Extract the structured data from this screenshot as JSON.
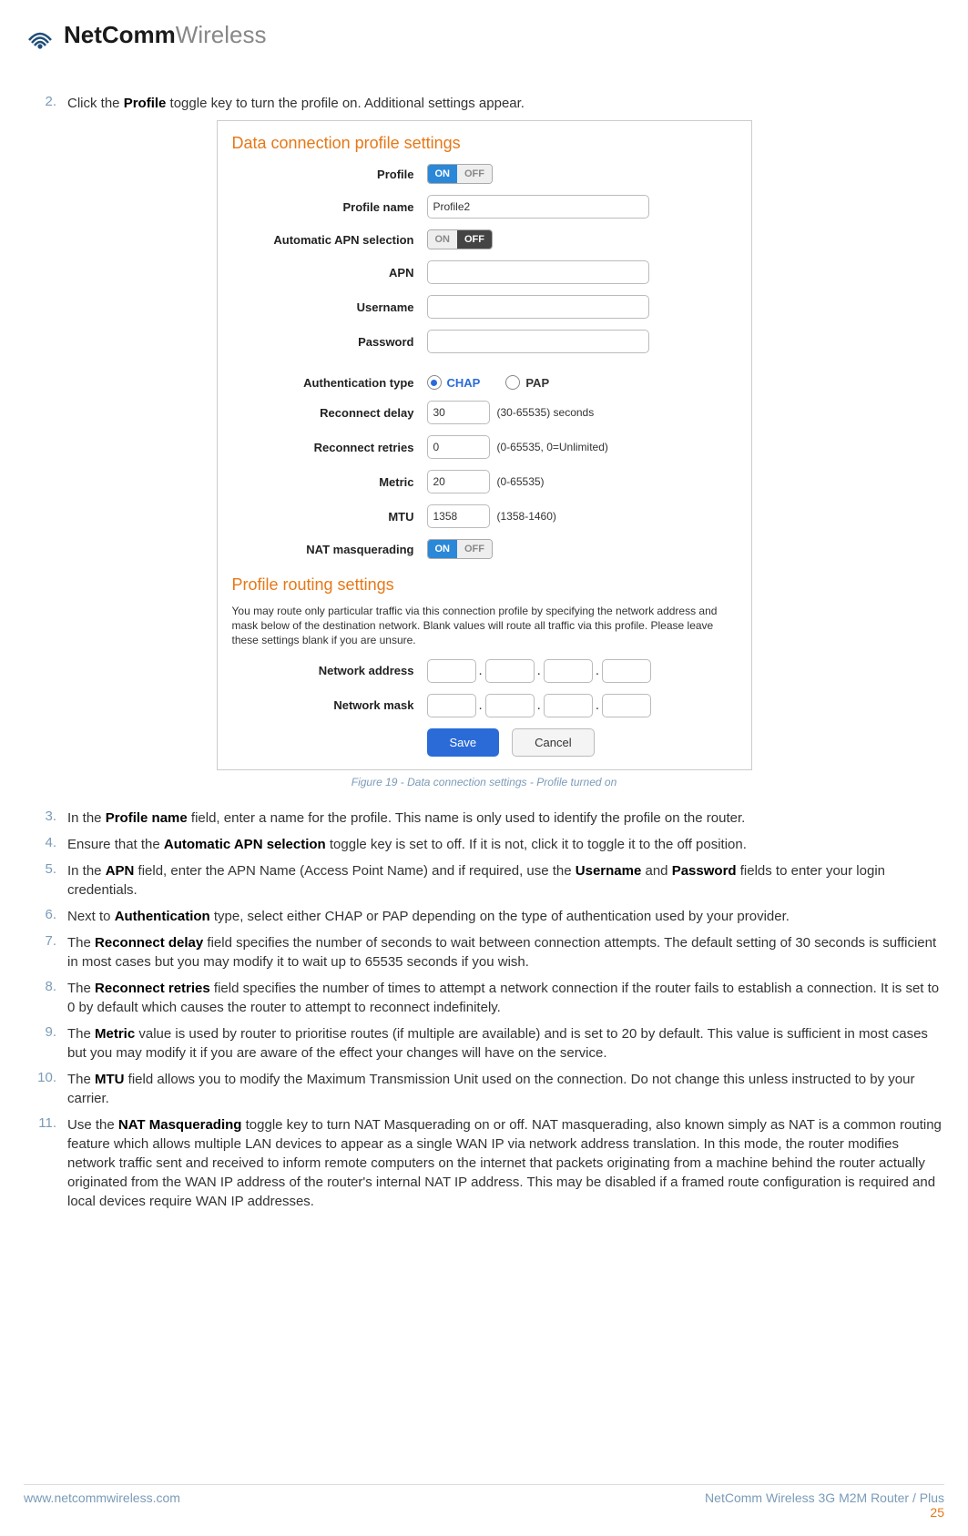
{
  "brand": {
    "bold": "NetComm",
    "light": "Wireless"
  },
  "steps": {
    "s2": {
      "n": "2.",
      "pre": "Click the ",
      "b": "Profile",
      "post": " toggle key to turn the profile on. Additional settings appear."
    },
    "s3": {
      "n": "3.",
      "pre": "In the ",
      "b": "Profile name",
      "post": " field, enter a name for the profile. This name is only used to identify the profile on the router."
    },
    "s4": {
      "n": "4.",
      "pre": "Ensure that the ",
      "b": "Automatic APN selection",
      "post": " toggle key is set to off. If it is not, click it to toggle it to the off position."
    },
    "s5": {
      "n": "5.",
      "pre": "In the ",
      "b1": "APN",
      "mid1": " field, enter the APN Name (Access Point Name) and if required, use the ",
      "b2": "Username",
      "mid2": " and ",
      "b3": "Password",
      "post": " fields to enter your login credentials."
    },
    "s6": {
      "n": "6.",
      "pre": "Next to ",
      "b": "Authentication",
      "post": " type, select either CHAP or PAP depending on the type of authentication used by your provider."
    },
    "s7": {
      "n": "7.",
      "pre": "The ",
      "b": "Reconnect delay",
      "post": " field specifies the number of seconds to wait between connection attempts. The default setting of 30 seconds is sufficient in most cases but you may modify it to wait up to 65535 seconds if you wish."
    },
    "s8": {
      "n": "8.",
      "pre": "The ",
      "b": "Reconnect retries",
      "post": " field specifies the number of times to attempt a network connection if the router fails to establish a connection. It is set to 0 by default which causes the router to attempt to reconnect indefinitely."
    },
    "s9": {
      "n": "9.",
      "pre": "The ",
      "b": "Metric",
      "post": " value is used by router to prioritise routes (if multiple are available) and is set to 20 by default. This value is sufficient in most cases but you may modify it if you are aware of the effect your changes will have on the service."
    },
    "s10": {
      "n": "10.",
      "pre": "The ",
      "b": "MTU",
      "post": " field allows you to modify the Maximum Transmission Unit used on the connection. Do not change this unless instructed to by your carrier."
    },
    "s11": {
      "n": "11.",
      "pre": "Use the ",
      "b": "NAT Masquerading",
      "post": " toggle key to turn NAT Masquerading on or off. NAT masquerading, also known simply as NAT is a common routing feature which allows multiple LAN devices to appear as a single WAN IP via network address translation. In this mode, the router modifies network traffic sent and received to inform remote computers on the internet that packets originating from a machine behind the router actually originated from the WAN IP address of the router's internal NAT IP address. This may be disabled if a framed route configuration is required and local devices require WAN IP addresses."
    }
  },
  "figure": {
    "title1": "Data connection profile settings",
    "title2": "Profile routing settings",
    "labels": {
      "profile": "Profile",
      "pname": "Profile name",
      "auto": "Automatic APN selection",
      "apn": "APN",
      "user": "Username",
      "pass": "Password",
      "auth": "Authentication type",
      "rdelay": "Reconnect delay",
      "rretry": "Reconnect retries",
      "metric": "Metric",
      "mtu": "MTU",
      "nat": "NAT masquerading",
      "netaddr": "Network address",
      "netmask": "Network mask"
    },
    "toggle": {
      "on": "ON",
      "off": "OFF"
    },
    "values": {
      "pname": "Profile2",
      "rdelay": "30",
      "rretry": "0",
      "metric": "20",
      "mtu": "1358"
    },
    "hints": {
      "rdelay": "(30-65535) seconds",
      "rretry": "(0-65535, 0=Unlimited)",
      "metric": "(0-65535)",
      "mtu": "(1358-1460)"
    },
    "auth": {
      "chap": "CHAP",
      "pap": "PAP"
    },
    "routing_desc": "You may route only particular traffic via this connection profile by specifying the network address and mask below of the destination network. Blank values will route all traffic via this profile. Please leave these settings blank if you are unsure.",
    "save": "Save",
    "cancel": "Cancel",
    "caption": "Figure 19 - Data connection settings - Profile turned on"
  },
  "footer": {
    "url": "www.netcommwireless.com",
    "product": "NetComm Wireless 3G M2M Router / Plus",
    "page": "25"
  }
}
